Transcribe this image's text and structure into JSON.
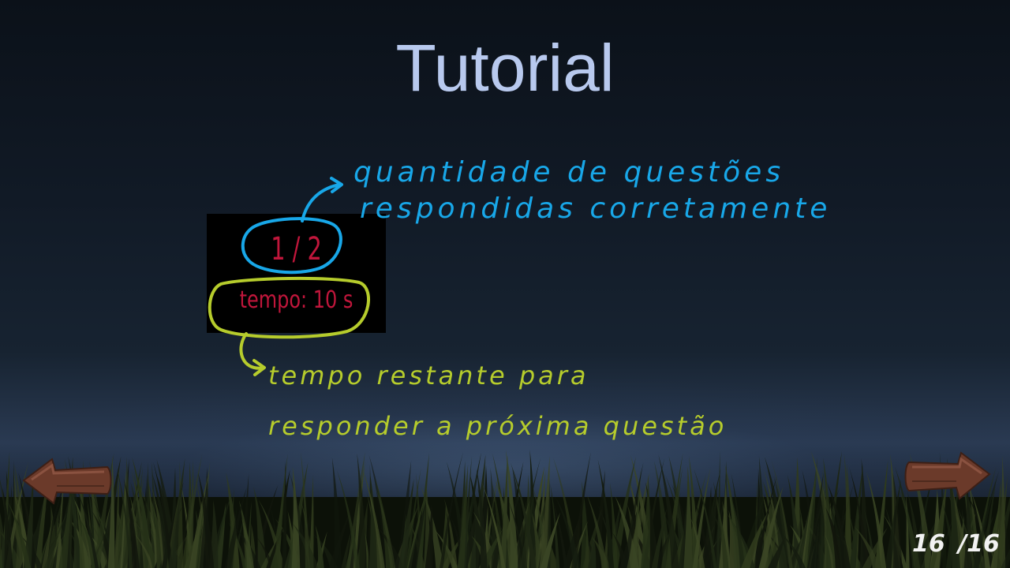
{
  "title": "Tutorial",
  "hud": {
    "score": "1 / 2",
    "timer": "tempo: 10 s"
  },
  "annotations": {
    "blue_line1": "quantidade de questões",
    "blue_line2": "respondidas corretamente",
    "yellow_line1": "tempo restante para",
    "yellow_line2": "responder a próxima questão"
  },
  "pagination": {
    "current": "16",
    "separator": "/",
    "total": "16"
  },
  "colors": {
    "title": "#b8c9ee",
    "hud_text": "#c0163b",
    "blue_note": "#18a7e8",
    "yellow_note": "#b6cc2c"
  },
  "icons": {
    "prev": "wooden-arrow-left-icon",
    "next": "wooden-arrow-right-icon"
  }
}
